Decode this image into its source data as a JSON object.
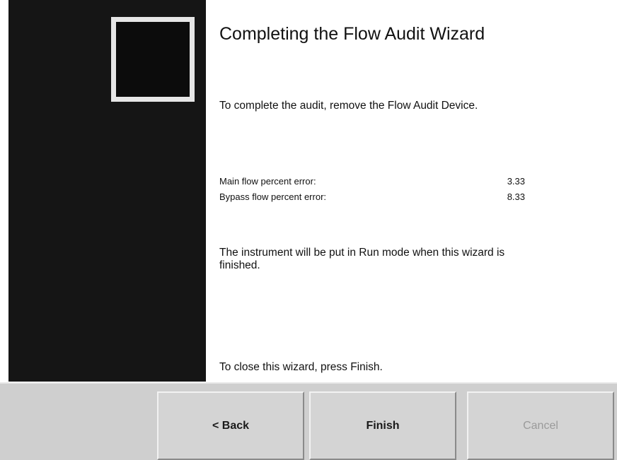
{
  "wizard": {
    "title": "Completing the Flow Audit Wizard",
    "intro": "To complete the audit, remove the Flow Audit Device.",
    "results": [
      {
        "label": "Main  flow percent error:",
        "value": "3.33"
      },
      {
        "label": "Bypass flow percent error:",
        "value": "8.33"
      }
    ],
    "run_note": "The instrument will be put in Run mode when this wizard is finished.",
    "close_hint": "To close this wizard, press Finish."
  },
  "buttons": {
    "back_label": "< Back",
    "finish_label": "Finish",
    "cancel_label": "Cancel"
  },
  "colors": {
    "side_panel": "#151515",
    "logo_border": "#e6e6e6",
    "button_face": "#d4d4d4",
    "disabled_text": "#9a9a9a"
  }
}
